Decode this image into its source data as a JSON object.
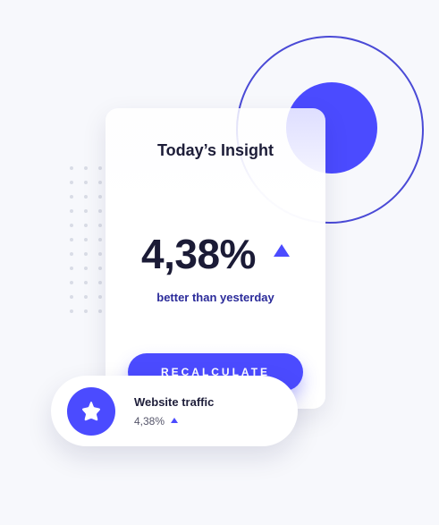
{
  "colors": {
    "accent": "#4b4bff",
    "outline_circle": "#4a4ad6",
    "title_text": "#1d1d38",
    "subtext_blue": "#2b2b9a",
    "background": "#f7f8fc"
  },
  "insight_card": {
    "title": "Today’s Insight",
    "value": "4,38%",
    "trend_icon": "triangle-up-icon",
    "subtitle": "better than yesterday",
    "button_label": "RECALCULATE"
  },
  "traffic_card": {
    "icon": "star-icon",
    "title": "Website traffic",
    "value": "4,38%",
    "trend_icon": "triangle-up-icon"
  },
  "decorations": {
    "dot_grid": {
      "rows": 11,
      "cols": 3
    },
    "outline_circle": true,
    "solid_circle": true
  }
}
